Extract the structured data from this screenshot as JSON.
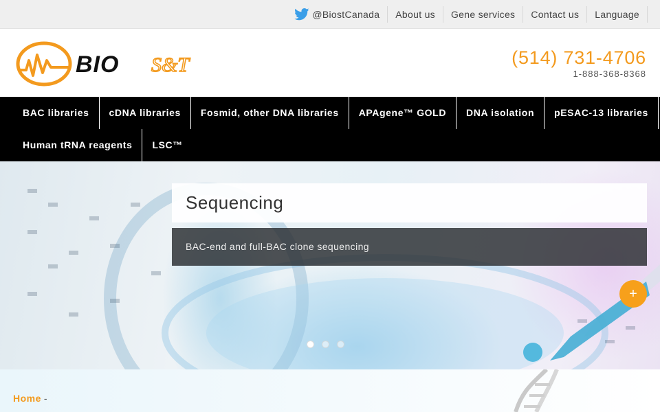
{
  "topbar": {
    "twitter_handle": "@BiostCanada",
    "links": [
      "About us",
      "Gene services",
      "Contact us",
      "Language"
    ]
  },
  "header": {
    "logo_text": "BIO S&T",
    "phone_main": "(514) 731-4706",
    "phone_tollfree": "1-888-368-8368"
  },
  "nav": {
    "row1": [
      "BAC libraries",
      "cDNA libraries",
      "Fosmid, other DNA libraries",
      "APAgene™ GOLD",
      "DNA isolation",
      "pESAC-13 libraries"
    ],
    "row2": [
      "Human tRNA reagents",
      "LSC™"
    ]
  },
  "hero": {
    "title": "Sequencing",
    "caption": "BAC-end and full-BAC clone sequencing",
    "plus_label": "+",
    "slide_count": 3,
    "active_slide": 1
  },
  "breadcrumb": {
    "home": "Home",
    "separator": "-"
  },
  "colors": {
    "accent": "#f39a1e",
    "nav_bg": "#000000",
    "topbar_bg": "#efefef"
  },
  "icons": {
    "twitter": "twitter-icon",
    "plus": "plus-icon"
  }
}
